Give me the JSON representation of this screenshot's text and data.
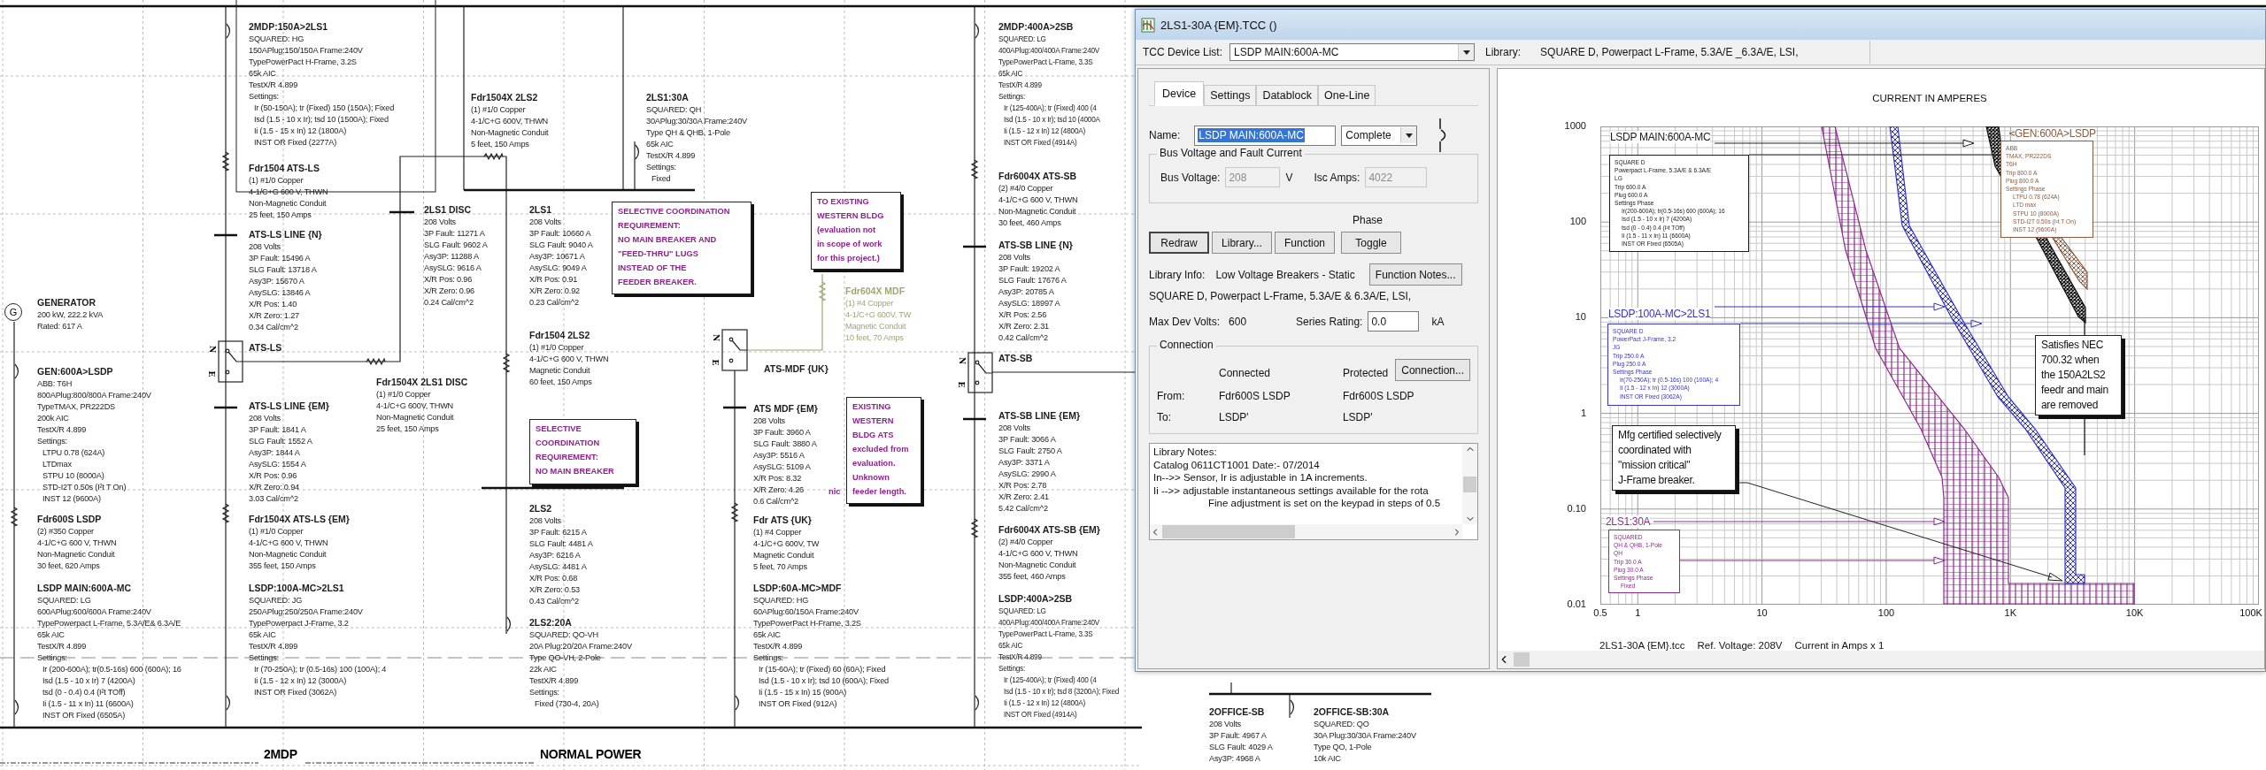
{
  "diagram": {
    "columns": [
      {
        "blocks": [
          {
            "kind": "device",
            "title": "GENERATOR",
            "lines": [
              "200 kW, 222.2 kVA",
              "Rated: 617 A"
            ]
          },
          {
            "kind": "device",
            "title": "GEN:600A>LSDP",
            "lines": [
              "ABB: T6H",
              "800APlug:800/800A Frame:240V",
              "TypeTMAX, PR222DS",
              "200k AIC",
              "TestX/R 4.899"
            ],
            "settings_label": "Settings:",
            "settings": [
              "LTPU 0.78 (624A)",
              "LTDmax",
              "STPU 10 (8000A)",
              "STD-I2T 0.50s (I²t T On)",
              "INST 12 (9600A)"
            ]
          },
          {
            "kind": "device",
            "title": "Fdr600S LSDP",
            "lines": [
              "(2) #350 Copper",
              "4-1/C+G 600 V, THWN",
              "Non-Magnetic Conduit",
              "30 feet, 620 Amps"
            ]
          },
          {
            "kind": "device",
            "title": "LSDP MAIN:600A-MC",
            "lines": [
              "SQUARED: LG",
              "600APlug:600/600A Frame:240V",
              "TypePowerpact L-Frame, 5.3A/E& 6.3A/E",
              "65k AIC",
              "TestX/R 4.899"
            ],
            "settings_label": "Settings:",
            "settings": [
              "Ir (200-600A); tr(0.5-16s) 600 (600A); 16",
              "Isd (1.5 - 10 x Ir) 7 (4200A)",
              "tsd (0 - 0.4) 0.4 (I²t TOff)",
              "Ii (1.5 - 11 x In) 11 (6600A)",
              "INST OR Fixed (6505A)"
            ]
          }
        ]
      },
      {
        "blocks": [
          {
            "kind": "device",
            "title": "2MDP:150A>2LS1",
            "lines": [
              "SQUARED: HG",
              "150APlug:150/150A Frame:240V",
              "TypePowerPact H-Frame, 3.2S",
              "65k AIC",
              "TestX/R 4.899"
            ],
            "settings_label": "Settings:",
            "settings": [
              "Ir (50-150A); tr (Fixed) 150 (150A); Fixed",
              "Isd (1.5 - 10 x Ir); tsd 10 (1500A); Fixed",
              "Ii (1.5 - 15 x In) 12 (1800A)",
              "INST OR Fixed (2277A)"
            ]
          },
          {
            "kind": "device",
            "title": "Fdr1504 ATS-LS",
            "lines": [
              "(1) #1/0 Copper",
              "4-1/C+G 600 V, THWN",
              "Non-Magnetic Conduit",
              "25 feet, 150 Amps"
            ]
          },
          {
            "kind": "device",
            "title": "ATS-LS LINE {N}",
            "lines": [
              "208 Volts",
              "3P Fault: 15496 A",
              "SLG Fault: 13718 A",
              "Asy3P: 15670 A",
              "AsySLG: 13846 A",
              "X/R Pos: 1.40",
              "X/R Zero: 1.27",
              "0.34 Cal/cm^2"
            ]
          },
          {
            "kind": "device",
            "title": "ATS-LS"
          },
          {
            "kind": "device",
            "title": "ATS-LS LINE {EM}",
            "lines": [
              "208 Volts",
              "3P Fault: 1841 A",
              "SLG Fault: 1552 A",
              "Asy3P: 1844 A",
              "AsySLG: 1554 A",
              "X/R Pos: 0.96",
              "X/R Zero: 0.94",
              "3.03 Cal/cm^2"
            ]
          },
          {
            "kind": "device",
            "title": "Fdr1504X ATS-LS {EM}",
            "lines": [
              "(1) #1/0 Copper",
              "4-1/C+G 600 V, THWN",
              "Non-Magnetic Conduit",
              "355 feet, 150 Amps"
            ]
          },
          {
            "kind": "device",
            "title": "LSDP:100A-MC>2LS1",
            "lines": [
              "SQUARED: JG",
              "250APlug:250/250A Frame:240V",
              "TypePowerpact J-Frame, 3.2",
              "65k AIC",
              "TestX/R 4.899"
            ],
            "settings_label": "Settings:",
            "settings": [
              "Ir (70-250A); tr (0.5-16s) 100 (100A); 4",
              "Ii (1.5 - 12 x In) 12 (3000A)",
              "INST OR Fixed (3062A)"
            ]
          }
        ]
      },
      {
        "blocks": [
          {
            "kind": "device",
            "title": "Fdr1504X 2LS2",
            "lines": [
              "(1) #1/0 Copper",
              "4-1/C+G 600V, THWN",
              "Non-Magnetic Conduit",
              "5 feet, 150 Amps"
            ]
          },
          {
            "kind": "device",
            "title": "2LS1 DISC",
            "lines": [
              "208 Volts",
              "3P Fault: 11271 A",
              "SLG Fault: 9602 A",
              "Asy3P: 11288 A",
              "AsySLG: 9616 A",
              "X/R Pos: 0.96",
              "X/R Zero: 0.96",
              "0.24 Cal/cm^2"
            ]
          },
          {
            "kind": "device",
            "title": "Fdr1504X 2LS1 DISC",
            "lines": [
              "(1) #1/0 Copper",
              "4-1/C+G 600V, THWN",
              "Non-Magnetic Conduit",
              "25 feet, 150 Amps"
            ]
          }
        ]
      },
      {
        "blocks": [
          {
            "kind": "device",
            "title": "2LS1",
            "lines": [
              "208 Volts",
              "3P Fault: 10660 A",
              "SLG Fault: 9040 A",
              "Asy3P: 10671 A",
              "AsySLG: 9049 A",
              "X/R Pos: 0.91",
              "X/R Zero: 0.92",
              "0.23 Cal/cm^2"
            ]
          },
          {
            "kind": "device",
            "title": "Fdr1504 2LS2",
            "lines": [
              "(1) #1/0 Copper",
              "4-1/C+G 600 V, THWN",
              "Magnetic Conduit",
              "60 feet, 150 Amps"
            ]
          },
          {
            "kind": "device",
            "title": "2LS2",
            "lines": [
              "208 Volts",
              "3P Fault: 6215 A",
              "SLG Fault: 4481 A",
              "Asy3P: 6216 A",
              "AsySLG: 4481 A",
              "X/R Pos: 0.68",
              "X/R Zero: 0.53",
              "0.43 Cal/cm^2"
            ]
          },
          {
            "kind": "device",
            "title": "2LS2:20A",
            "lines": [
              "SQUARED: QO-VH",
              "20A Plug:20/20A Frame:240V",
              "Type QO-VH, 2-Pole",
              "22k AIC",
              "TestX/R 4.899"
            ],
            "settings_label": "Settings:",
            "settings": [
              "Fixed (730-4, 20A)"
            ]
          }
        ]
      },
      {
        "blocks": [
          {
            "kind": "device",
            "title": "2LS1:30A",
            "lines": [
              "SQUARED: QH",
              "30APlug:30/30A Frame:240V",
              "Type QH & QHB, 1-Pole",
              "65k AIC",
              "TestX/R 4.899"
            ],
            "settings_label": "Settings:",
            "settings": [
              "Fixed"
            ]
          }
        ]
      },
      {
        "blocks": [
          {
            "kind": "dimmed",
            "title": "Fdr604X MDF",
            "lines": [
              "(1) #4 Copper",
              "4-1/C+G 600V, TW",
              "Magnetic Conduit",
              "10 feet, 70 Amps"
            ]
          },
          {
            "kind": "device",
            "title": "ATS-MDF {UK}"
          },
          {
            "kind": "device",
            "title": "ATS MDF {EM}",
            "lines": [
              "208 Volts",
              "3P Fault: 3960 A",
              "SLG Fault: 3880 A",
              "Asy3P: 5516 A",
              "AsySLG: 5109 A",
              "X/R Pos: 8.32",
              "X/R Zero: 4.26",
              "0.6 Cal/cm^2"
            ]
          },
          {
            "kind": "device",
            "title": "Fdr ATS {UK}",
            "lines": [
              "(1) #4 Copper",
              "4-1/C+G 600V, TW",
              "Magnetic Conduit",
              "5 feet, 70 Amps"
            ]
          },
          {
            "kind": "device",
            "title": "LSDP:60A-MC>MDF",
            "lines": [
              "SQUARED: HG",
              "60APlug:60/150A Frame:240V",
              "TypePowerPact H-Frame, 3.2S",
              "65k AIC",
              "TestX/R 4.899"
            ],
            "settings_label": "Settings:",
            "settings": [
              "Ir (15-60A); tr (Fixed) 60 (60A); Fixed",
              "Isd (1.5 - 10 x Ir); tsd 10 (600A); Fixed",
              "Ii (1.5 - 15 x In) 15 (900A)",
              "INST OR Fixed (912A)"
            ]
          }
        ]
      },
      {
        "blocks": [
          {
            "kind": "device",
            "title": "2MDP:400A>2SB",
            "lines": [
              "SQUARED: LG",
              "400APlug:400/400A Frame:240V",
              "TypePowerPact L-Frame, 3.3S",
              "65k AIC",
              "TestX/R 4.899"
            ],
            "settings_label": "Settings:",
            "settings": [
              "Ir (125-400A); tr (Fixed) 400 (4",
              "Isd (1.5 - 10 x Ir); tsd 10 (4000A",
              "Ii (1.5 - 12 x In) 12 (4800A)",
              "INST OR Fixed (4914A)"
            ]
          },
          {
            "kind": "device",
            "title": "Fdr6004X ATS-SB",
            "lines": [
              "(2) #4/0 Copper",
              "4-1/C+G 600 V, THWN",
              "Non-Magnetic Conduit",
              "30 feet, 460 Amps"
            ]
          },
          {
            "kind": "device",
            "title": "ATS-SB LINE {N}",
            "lines": [
              "208 Volts",
              "3P Fault: 19202 A",
              "SLG Fault: 17676 A",
              "Asy3P: 20785 A",
              "AsySLG: 18997 A",
              "X/R Pos: 2.56",
              "X/R Zero: 2.31",
              "0.42 Cal/cm^2"
            ]
          },
          {
            "kind": "device",
            "title": "ATS-SB"
          },
          {
            "kind": "device",
            "title": "ATS-SB LINE {EM}",
            "lines": [
              "208 Volts",
              "3P Fault: 3066 A",
              "SLG Fault: 2750 A",
              "Asy3P: 3371 A",
              "AsySLG: 2990 A",
              "X/R Pos: 2.78",
              "X/R Zero: 2.41",
              "5.42 Cal/cm^2"
            ]
          },
          {
            "kind": "device",
            "title": "Fdr6004X ATS-SB {EM}",
            "lines": [
              "(2) #4/0 Copper",
              "4-1/C+G 600 V, THWN",
              "Non-Magnetic Conduit",
              "355 feet, 460 Amps"
            ]
          },
          {
            "kind": "device",
            "title": "LSDP:400A>2SB",
            "lines": [
              "SQUARED: LG",
              "400APlug:400/400A Frame:240V",
              "TypePowerPact L-Frame, 3.3S",
              "65k AIC",
              "TestX/R 4.899"
            ],
            "settings_label": "Settings:",
            "settings": [
              "Ir (125-400A); tr (Fixed) 400 (4",
              "Isd (1.5 - 10 x Ir); tsd 8 (3200A); Fixed",
              "Ii (1.5 - 12 x In) 12 (4800A)",
              "INST OR Fixed (4914A)"
            ]
          }
        ]
      },
      {
        "blocks": [
          {
            "kind": "device",
            "title": "2OFFICE-SB",
            "lines": [
              "208 Volts",
              "3P Fault: 4967 A",
              "SLG Fault: 4029 A",
              "Asy3P: 4968 A"
            ]
          },
          {
            "kind": "device",
            "title": "2OFFICE-SB:30A",
            "lines": [
              "SQUARED: QO",
              "30A Plug:30/30A Frame:240V",
              "Type QO, 1-Pole",
              "10k AIC"
            ]
          }
        ]
      }
    ],
    "notes": [
      {
        "lines": [
          "SELECTIVE",
          "COORDINATION",
          "REQUIREMENT:",
          "NO MAIN BREAKER"
        ]
      },
      {
        "lines": [
          "SELECTIVE COORDINATION",
          "REQUIREMENT:",
          "NO MAIN BREAKER AND",
          "\"FEED-THRU\" LUGS",
          "INSTEAD OF THE",
          "FEEDER BREAKER."
        ]
      },
      {
        "lines": [
          "TO EXISTING",
          "WESTERN BLDG",
          "(evaluation not",
          "in scope of work",
          "for this project.)"
        ]
      },
      {
        "lines": [
          "EXISTING",
          "WESTERN",
          "BLDG ATS",
          "excluded from",
          "evaluation.",
          "Unknown",
          "feeder length."
        ]
      }
    ],
    "transfer_switches": [
      {
        "top": "N",
        "bottom": "E"
      },
      {
        "top": "N",
        "bottom": "E"
      },
      {
        "top": "N",
        "bottom": "E"
      }
    ],
    "generator_symbol": "G",
    "stray_text": "nic",
    "section_labels": [
      "2MDP",
      "NORMAL POWER"
    ]
  },
  "dialog": {
    "title": "2LS1-30A {EM}.TCC ()",
    "device_list_label": "TCC Device List:",
    "device_list_value": "LSDP MAIN:600A-MC",
    "library_label": "Library:",
    "library_value": "SQUARE D, Powerpact L-Frame, 5.3A/E _6.3A/E, LSI,",
    "tabs": [
      {
        "label": "Device",
        "selected": true
      },
      {
        "label": "Settings",
        "selected": false
      },
      {
        "label": "Datablock",
        "selected": false
      },
      {
        "label": "One-Line",
        "selected": false
      }
    ],
    "name_label": "Name:",
    "name_value": "LSDP MAIN:600A-MC",
    "name_mode": "Complete",
    "bus_group": {
      "title": "Bus Voltage and Fault Current",
      "fields": [
        {
          "label": "Bus Voltage:",
          "value": "208",
          "unit": "V",
          "disabled": true
        },
        {
          "label": "Isc Amps:",
          "value": "4022",
          "disabled": true
        }
      ]
    },
    "phase_label": "Phase",
    "buttons": [
      "Redraw",
      "Library...",
      "Function",
      "Toggle"
    ],
    "library_info_label": "Library Info:",
    "library_info_value": "Low Voltage Breakers - Static",
    "function_notes_button": "Function Notes...",
    "library_description": "SQUARE D, Powerpact L-Frame, 5.3A/E & 6.3A/E, LSI,",
    "max_dev_volts_label": "Max Dev Volts:",
    "max_dev_volts_value": "600",
    "series_rating_label": "Series Rating:",
    "series_rating_value": "0.0",
    "series_rating_unit": "kA",
    "connection": {
      "title": "Connection",
      "connected_heading": "Connected",
      "protected_heading": "Protected",
      "button": "Connection...",
      "rows": [
        {
          "label": "From:",
          "connected": "Fdr600S LSDP",
          "protected": "Fdr600S LSDP"
        },
        {
          "label": "To:",
          "connected": "LSDP'",
          "protected": "LSDP'"
        }
      ]
    },
    "library_notes": [
      "Library Notes:",
      "Catalog 0611CT1001  Date:- 07/2014",
      "In-->> Sensor, Ir is adjustable in 1A increments.",
      "Ii -->> adjustable instantaneous settings available for the rota"
    ],
    "library_notes_continuation": "Fine adjustment is set on the keypad in steps of 0.5",
    "chart": {
      "title": "CURRENT IN AMPERES",
      "y_labels": [
        "1000",
        "100",
        "10",
        "1",
        "0.10",
        "0.01"
      ],
      "x_labels": [
        "0.5",
        "1",
        "10",
        "100",
        "1K",
        "10K",
        "100K"
      ],
      "annotations": [
        {
          "kind": "device",
          "title": "LSDP MAIN:600A-MC",
          "color": "#1a1a1a",
          "lines": [
            "SQUARE D",
            "Powerpact L-Frame, 5.3A/E & 6.3A/E",
            "LG",
            "Trip 600.0 A",
            "Plug 600.0 A",
            "Settings Phase",
            "Ir(200-600A); tr(0.5-16s) 600 (600A); 16",
            "Isd (1.5 - 10 x Ir) 7 (4200A)",
            "tsd (0 - 0.4) 0.4 (I²t TOff)",
            "Ii (1.5 - 11 x In) 11 (6600A)",
            "INST OR Fixed (6505A)"
          ]
        },
        {
          "kind": "device",
          "title": "GEN:600A>LSDP",
          "color": "#8b5a40",
          "lines": [
            "ABB",
            "TMAX, PR222DS",
            "T6H",
            "Trip 800.0 A",
            "Plug 800.0 A",
            "Settings Phase",
            "LTPU 0.78 (624A)",
            "LTD max",
            "STPU 10 (8000A)",
            "STD-I2T 0.50s (I²t T On)",
            "INST 12 (9600A)"
          ]
        },
        {
          "kind": "device",
          "title": "LSDP:100A-MC>2LS1",
          "color": "#3434c8",
          "lines": [
            "SQUARE D",
            "PowerPact J-Frame, 3.2",
            "JG",
            "Trip 250.0 A",
            "Plug 250.0 A",
            "Settings Phase",
            "Ir(70-250A); tr (0.5-16s) 100 (100A); 4",
            "Ii (1.5 - 12 x In) 12 (3000A)",
            "INST OR Fixed (3062A)"
          ]
        },
        {
          "kind": "note",
          "lines": [
            "Satisfies NEC",
            "700.32 when",
            "the 150A2LS2",
            "feedr and main",
            "are removed"
          ]
        },
        {
          "kind": "note",
          "lines": [
            "Mfg certified selectively",
            "coordinated with",
            "\"mission critical\"",
            "J-Frame breaker."
          ]
        },
        {
          "kind": "device",
          "title": "2LS1:30A",
          "color": "#8e2a8e",
          "lines": [
            "SQUARED",
            "QH & QHB, 1-Pole",
            "QH",
            "Trip 30.0 A",
            "Plug 30.0 A",
            "Settings Phase",
            "Fixed"
          ]
        }
      ],
      "footer": [
        "2LS1-30A {EM}.tcc",
        "Ref. Voltage: 208V",
        "Current in Amps x 1"
      ]
    }
  }
}
